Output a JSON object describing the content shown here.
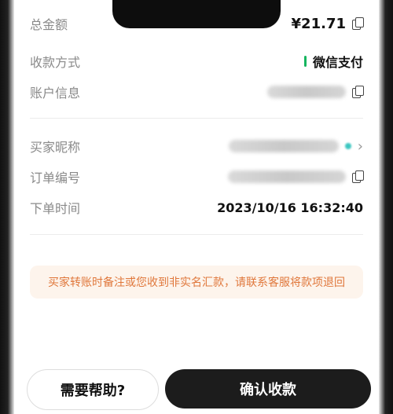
{
  "summary": {
    "total_label": "总金额",
    "total_value": "¥21.71"
  },
  "payment": {
    "method_label": "收款方式",
    "method_value": "微信支付",
    "account_label": "账户信息"
  },
  "order": {
    "buyer_label": "买家昵称",
    "order_no_label": "订单编号",
    "time_label": "下单时间",
    "time_value": "2023/10/16 16:32:40"
  },
  "notice_text": "买家转账时备注或您收到非实名汇款，请联系客服将款项退回",
  "actions": {
    "help_label": "需要帮助?",
    "confirm_label": "确认收款"
  },
  "colors": {
    "accent_green": "#16b55f",
    "notice_text": "#e0773b",
    "notice_bg": "#fdf4ec",
    "confirm_bg": "#1c1c1c"
  }
}
